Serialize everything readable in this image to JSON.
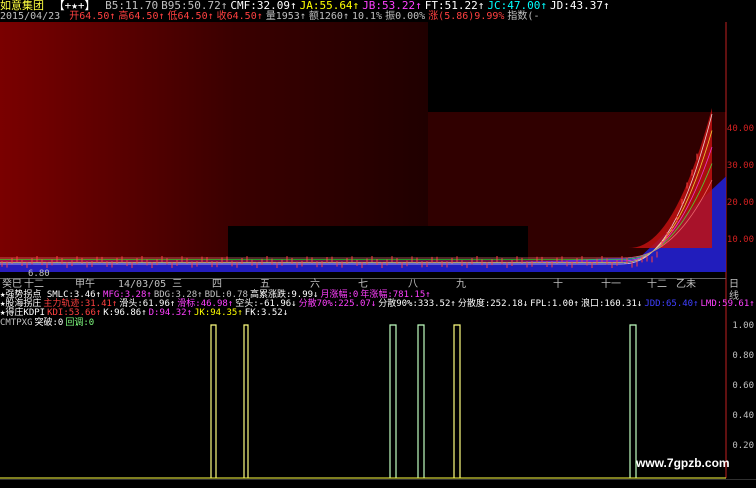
{
  "header": {
    "stock_name": "如意集团",
    "stock_tag": "【+★+】",
    "metrics": [
      {
        "label": "B5:",
        "value": "11.70",
        "color": "#c0c0c0"
      },
      {
        "label": "B95:",
        "value": "50.72↑",
        "color": "#c0c0c0"
      },
      {
        "label": "CMF:",
        "value": "32.09↑",
        "color": "#ffffff"
      },
      {
        "label": "JA:",
        "value": "55.64↑",
        "color": "#ffff00"
      },
      {
        "label": "JB:",
        "value": "53.22↑",
        "color": "#ff40ff"
      },
      {
        "label": "FT:",
        "value": "51.22↑",
        "color": "#ffffff"
      },
      {
        "label": "JC:",
        "value": "47.00↑",
        "color": "#00ffff"
      },
      {
        "label": "JD:",
        "value": "43.37↑",
        "color": "#ffffff"
      }
    ]
  },
  "quote": {
    "date": "2015/04/23",
    "items": [
      {
        "label": "开",
        "value": "64.50↑",
        "color": "#ff4040"
      },
      {
        "label": "高",
        "value": "64.50↑",
        "color": "#ff4040"
      },
      {
        "label": "低",
        "value": "64.50↑",
        "color": "#ff4040"
      },
      {
        "label": "收",
        "value": "64.50↑",
        "color": "#ff4040"
      },
      {
        "label": "量",
        "value": "1953↑",
        "color": "#c0c0c0"
      },
      {
        "label": "额",
        "value": "1260↑",
        "color": "#c0c0c0"
      },
      {
        "label": "",
        "value": "10.1%",
        "color": "#c0c0c0"
      },
      {
        "label": "振",
        "value": "0.00%",
        "color": "#c0c0c0"
      },
      {
        "label": "涨",
        "value": "(5.86)9.99%",
        "color": "#ff4040"
      },
      {
        "label": "指数",
        "value": "(-",
        "color": "#c0c0c0"
      }
    ]
  },
  "main_axis": {
    "ticks": [
      "40.00",
      "30.00",
      "20.00",
      "10.00"
    ]
  },
  "timebar": {
    "labels": [
      "癸巳",
      "十二",
      "甲午",
      "14/03/05 三",
      "四",
      "五",
      "六",
      "七",
      "八",
      "九",
      "十",
      "十一",
      "十二",
      "乙未",
      "日线"
    ]
  },
  "low_label": "6.80",
  "indicators": {
    "row1": [
      {
        "text": "★强势拐点 SMLC:3.46↑",
        "color": "#ffffff"
      },
      {
        "text": "MFG:3.28↑",
        "color": "#ff40ff"
      },
      {
        "text": "BDG:3.28↑",
        "color": "#c0c0c0"
      },
      {
        "text": "BDL:0.78",
        "color": "#c0c0c0"
      },
      {
        "text": "高累涨跌:9.99↓",
        "color": "#ffffff"
      },
      {
        "text": "月涨幅:0",
        "color": "#ff40ff"
      },
      {
        "text": "年涨幅:781.15↑",
        "color": "#ff40ff"
      }
    ],
    "row2": [
      {
        "text": "★股海拐庄",
        "color": "#ffffff"
      },
      {
        "text": "主力轨迹:31.41↑",
        "color": "#ff4040"
      },
      {
        "text": "滑头:61.96↑",
        "color": "#ffffff"
      },
      {
        "text": "滑标:46.98↑",
        "color": "#ff40ff"
      },
      {
        "text": "空头:-61.96↓",
        "color": "#ffffff"
      },
      {
        "text": "分散70%:225.07↓",
        "color": "#ff40ff"
      },
      {
        "text": "分散90%:333.52↑",
        "color": "#ffffff"
      },
      {
        "text": "分散度:252.18↓",
        "color": "#ffffff"
      },
      {
        "text": "FPL:1.00↑",
        "color": "#ffffff"
      },
      {
        "text": "浪口:160.31↓",
        "color": "#ffffff"
      },
      {
        "text": "JDD:65.40↑",
        "color": "#4040ff"
      },
      {
        "text": "LMD:59.61↑",
        "color": "#ff40ff"
      }
    ],
    "row3": [
      {
        "text": "★得庄KDPI",
        "color": "#ffffff"
      },
      {
        "text": "KDI:53.66↑",
        "color": "#ff4040"
      },
      {
        "text": "K:96.86↑",
        "color": "#ffffff"
      },
      {
        "text": "D:94.32↑",
        "color": "#ff40ff"
      },
      {
        "text": "JK:94.35↑",
        "color": "#ffff00"
      },
      {
        "text": "FK:3.52↓",
        "color": "#ffffff"
      }
    ],
    "row4": [
      {
        "text": "CMTPXG",
        "color": "#c0c0c0"
      },
      {
        "text": "突破:0",
        "color": "#ffffff"
      },
      {
        "text": "回调:0",
        "color": "#80ff80"
      }
    ]
  },
  "sub_axis": {
    "ticks": [
      "1.00",
      "0.80",
      "0.60",
      "0.40",
      "0.20"
    ]
  },
  "watermark": "www.7gpzb.com",
  "colors": {
    "up": "#ff4040",
    "ma_blue": "#3030ff",
    "signal_green": "#c0ffc0",
    "signal_yellow": "#ffff80"
  }
}
